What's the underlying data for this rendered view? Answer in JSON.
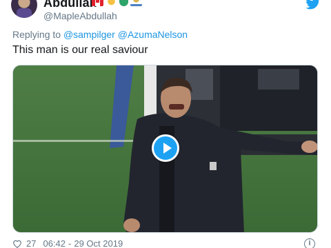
{
  "author": {
    "display_name": "Abdullah",
    "handle": "@MapleAbdullah",
    "badges": [
      "canada-flag-icon",
      "sparkle-star-icon",
      "green-shield-icon",
      "trophy-icon"
    ]
  },
  "reply": {
    "prefix": "Replying to",
    "mentions": [
      "@sampilger",
      "@AzumaNelson"
    ]
  },
  "tweet": {
    "text": "This man is our real saviour"
  },
  "media": {
    "type": "video",
    "play_icon": "play-icon"
  },
  "footer": {
    "likes": "27",
    "time": "06:42",
    "separator": "-",
    "date": "29 Oct 2019"
  },
  "colors": {
    "link": "#1b95e0",
    "secondary_text": "#657786",
    "brand_blue": "#1da1f2"
  }
}
